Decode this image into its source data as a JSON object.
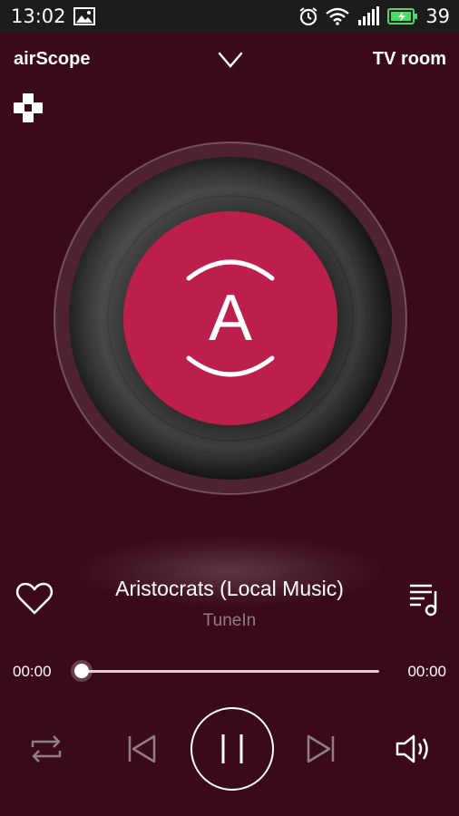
{
  "status_bar": {
    "time": "13:02",
    "battery_level": "39",
    "icons": [
      "image-icon",
      "alarm-icon",
      "wifi-icon",
      "signal-icon",
      "battery-icon"
    ]
  },
  "header": {
    "app_name": "airScope",
    "room": "TV room",
    "collapse_icon": "chevron-down-icon",
    "service_icon": "tunein-icon"
  },
  "now_playing": {
    "title": "Aristocrats (Local Music)",
    "source": "TuneIn",
    "disc_logo_letter": "A",
    "disc_label_color": "#bd1f4d"
  },
  "progress": {
    "current": "00:00",
    "total": "00:00",
    "fraction": 0.0
  },
  "controls": {
    "repeat_icon": "repeat-icon",
    "previous_icon": "skip-previous-icon",
    "play_state_icon": "pause-icon",
    "next_icon": "skip-next-icon",
    "volume_icon": "volume-icon",
    "favorite_icon": "heart-icon",
    "playlist_icon": "playlist-icon"
  },
  "colors": {
    "background": "#3a0a18",
    "accent": "#bd1f4d",
    "status_bar": "#1c1c1c",
    "secondary_text": "#8f7f85"
  }
}
